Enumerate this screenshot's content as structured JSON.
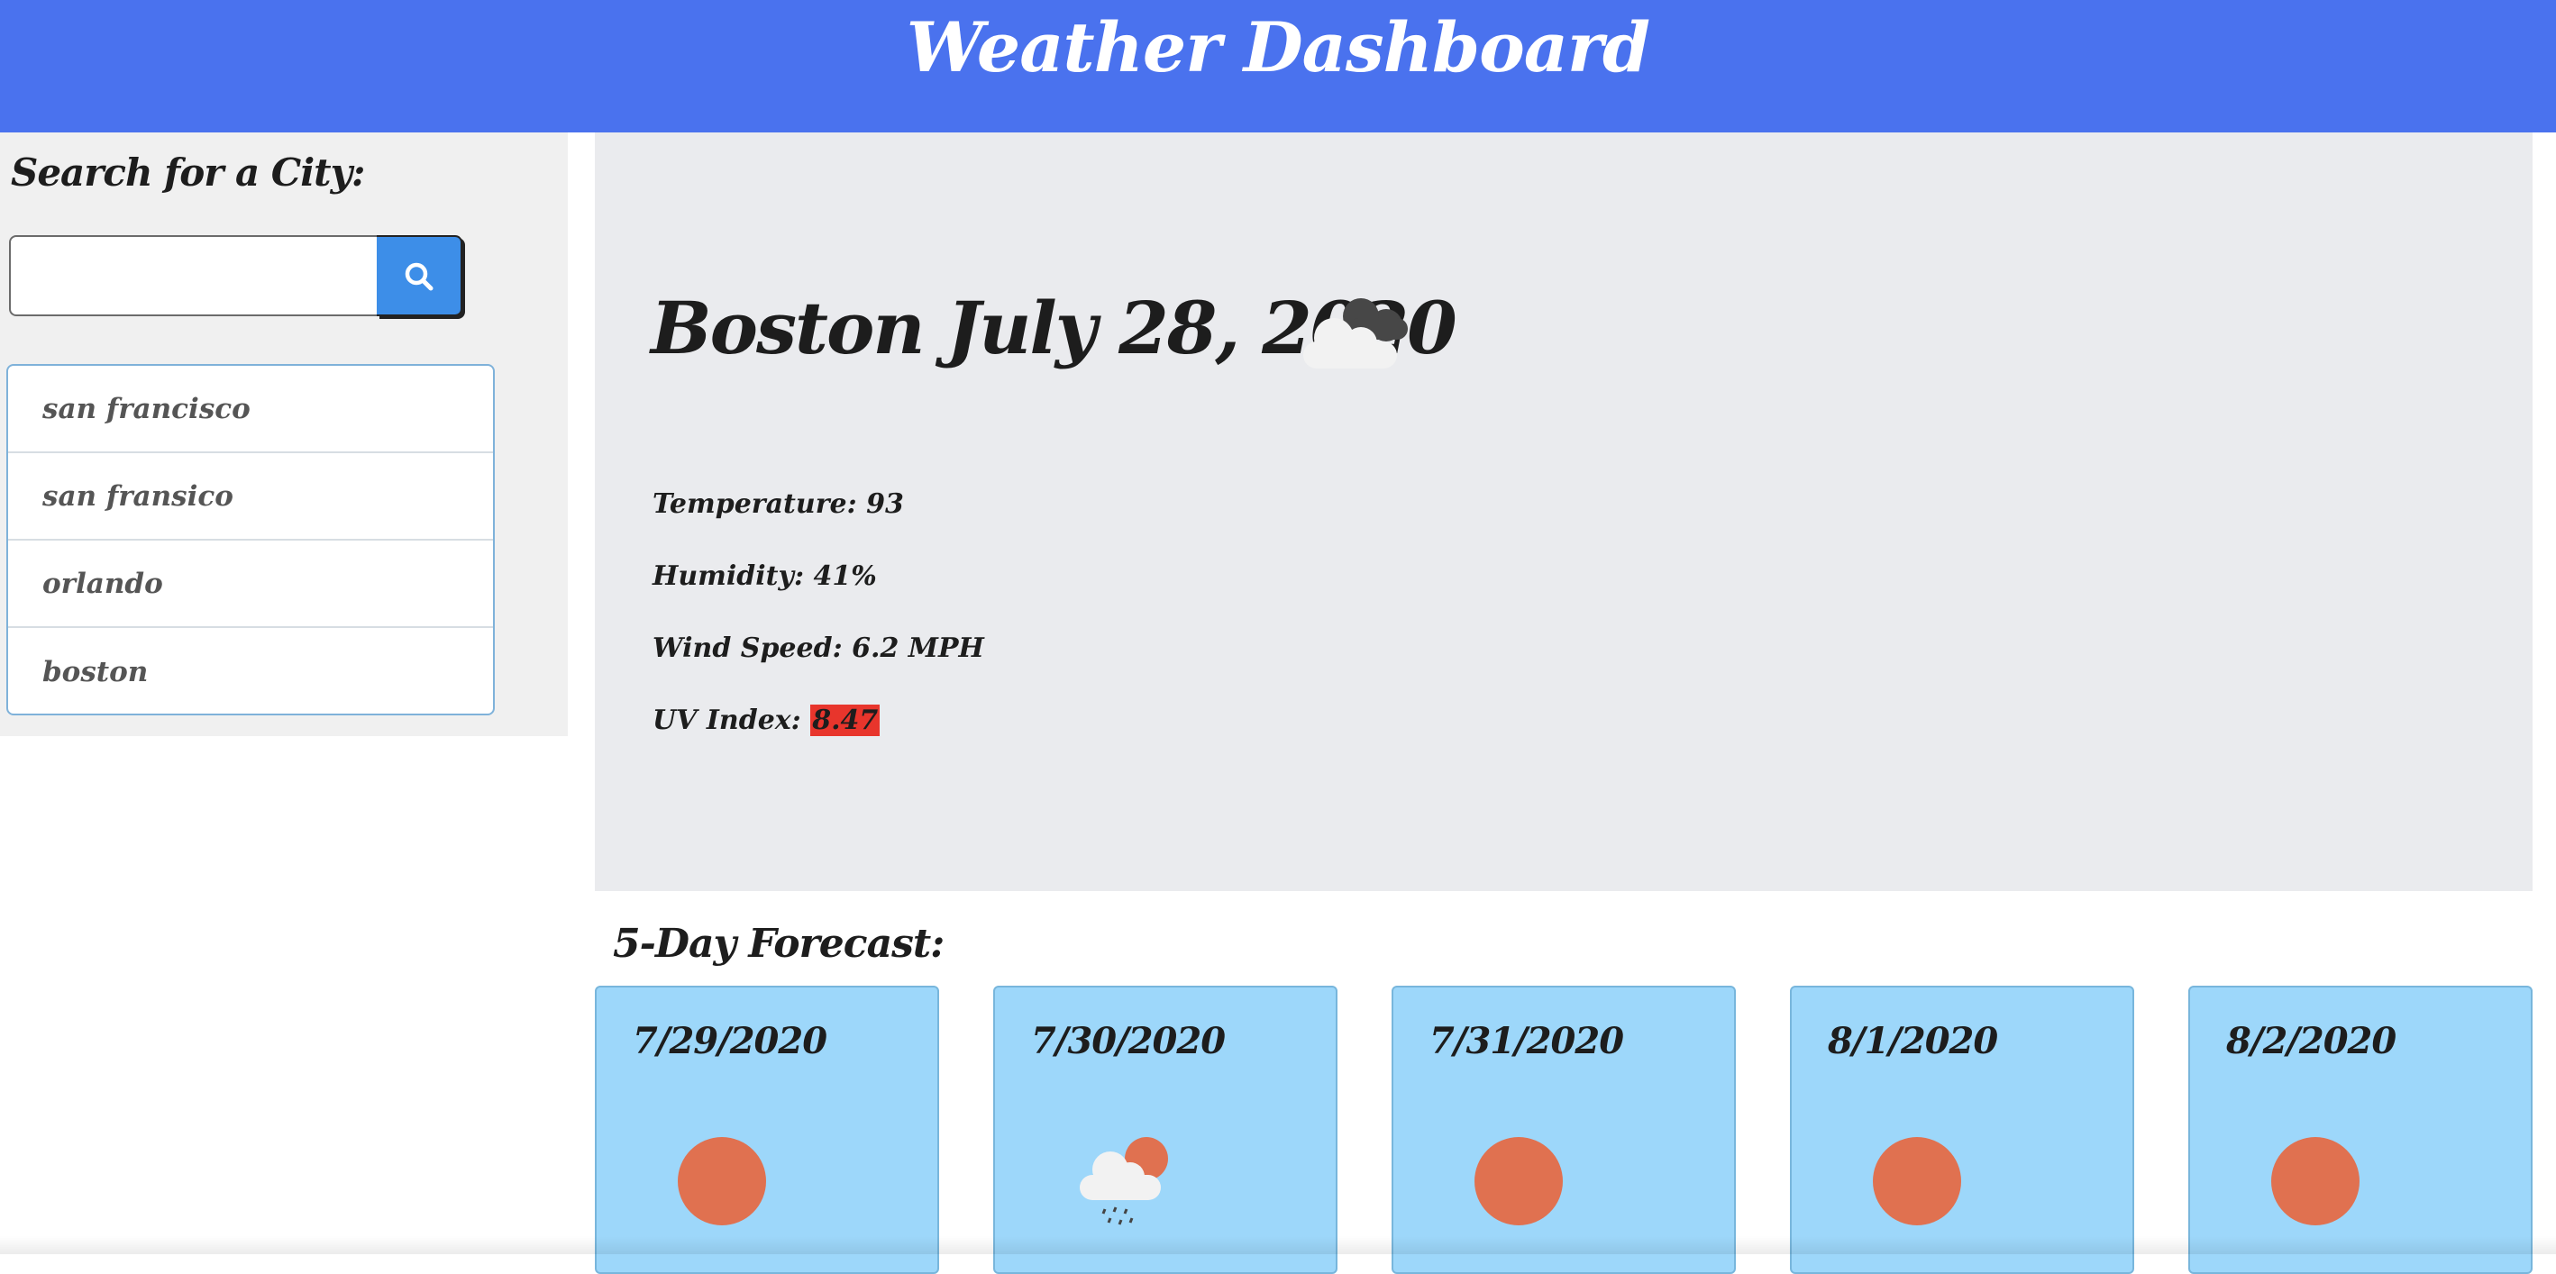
{
  "header": {
    "title": "Weather Dashboard"
  },
  "sidebar": {
    "heading": "Search for a City:",
    "search": {
      "value": "",
      "placeholder": ""
    },
    "search_button_icon": "search-icon",
    "history": [
      "san francisco",
      "san fransico",
      "orlando",
      "boston"
    ]
  },
  "current": {
    "title": "Boston July 28, 2020",
    "icon": "broken-clouds-icon",
    "temperature_label": "Temperature:",
    "temperature": "93",
    "humidity_label": "Humidity:",
    "humidity": "41%",
    "wind_label": "Wind Speed:",
    "wind": "6.2 MPH",
    "uv_label": "UV Index:",
    "uv": "8.47",
    "uv_color": "#e8352c"
  },
  "forecast": {
    "heading": "5-Day Forecast:",
    "days": [
      {
        "date": "7/29/2020",
        "icon": "sun-icon"
      },
      {
        "date": "7/30/2020",
        "icon": "rain-sun-cloud-icon"
      },
      {
        "date": "7/31/2020",
        "icon": "sun-icon"
      },
      {
        "date": "8/1/2020",
        "icon": "sun-icon"
      },
      {
        "date": "8/2/2020",
        "icon": "sun-icon"
      }
    ]
  },
  "colors": {
    "header": "#4a72ee",
    "card": "#9dd7fa",
    "search_button": "#3d8ee8",
    "sun": "#e07150"
  }
}
